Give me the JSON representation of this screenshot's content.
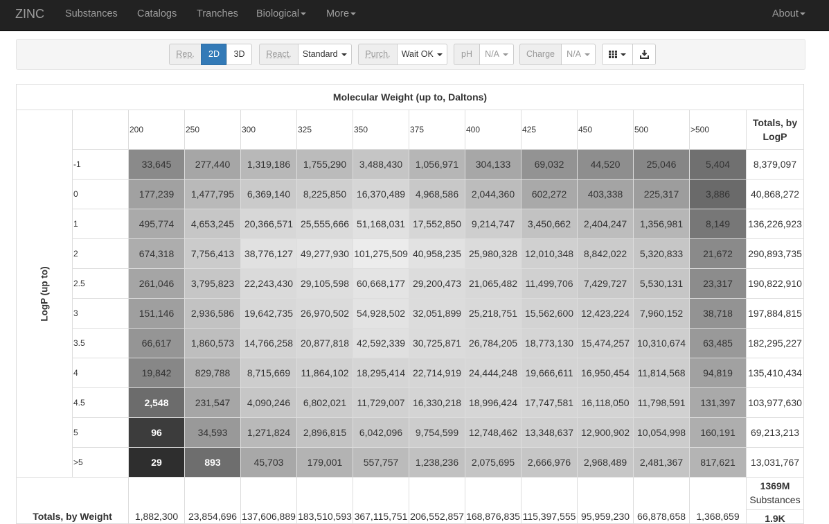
{
  "navbar": {
    "brand": "ZINC",
    "items": [
      "Substances",
      "Catalogs",
      "Tranches",
      "Biological",
      "More"
    ],
    "right": "About"
  },
  "toolbar": {
    "rep_label": "Rep.",
    "rep_2d": "2D",
    "rep_3d": "3D",
    "react_label": "React.",
    "react_value": "Standard",
    "purch_label": "Purch.",
    "purch_value": "Wait OK",
    "ph_label": "pH",
    "ph_value": "N/A",
    "charge_label": "Charge",
    "charge_value": "N/A",
    "grid_icon": "th-icon",
    "download_icon": "download-icon"
  },
  "table": {
    "title": "Molecular Weight (up to, Daltons)",
    "y_axis_label": "LogP (up to)",
    "mw_columns": [
      "200",
      "250",
      "300",
      "325",
      "350",
      "375",
      "400",
      "425",
      "450",
      "500",
      ">500"
    ],
    "totals_by_logp_label": "Totals, by LogP",
    "logp_rows": [
      "-1",
      "0",
      "1",
      "2",
      "2.5",
      "3",
      "3.5",
      "4",
      "4.5",
      "5",
      ">5"
    ],
    "cells": [
      [
        "33,645",
        "277,440",
        "1,319,186",
        "1,755,290",
        "3,488,430",
        "1,056,971",
        "304,133",
        "69,032",
        "44,520",
        "25,046",
        "5,404"
      ],
      [
        "177,239",
        "1,477,795",
        "6,369,140",
        "8,225,850",
        "16,370,489",
        "4,968,586",
        "2,044,360",
        "602,272",
        "403,338",
        "225,317",
        "3,886"
      ],
      [
        "495,774",
        "4,653,245",
        "20,366,571",
        "25,555,666",
        "51,168,031",
        "17,552,850",
        "9,214,747",
        "3,450,662",
        "2,404,247",
        "1,356,981",
        "8,149"
      ],
      [
        "674,318",
        "7,756,413",
        "38,776,127",
        "49,277,930",
        "101,275,509",
        "40,958,235",
        "25,980,328",
        "12,010,348",
        "8,842,022",
        "5,320,833",
        "21,672"
      ],
      [
        "261,046",
        "3,795,823",
        "22,243,430",
        "29,105,598",
        "60,668,177",
        "29,200,473",
        "21,065,482",
        "11,499,706",
        "7,429,727",
        "5,530,131",
        "23,317"
      ],
      [
        "151,146",
        "2,936,586",
        "19,642,735",
        "26,970,502",
        "54,928,502",
        "32,051,899",
        "25,218,751",
        "15,562,600",
        "12,423,224",
        "7,960,152",
        "38,718"
      ],
      [
        "66,617",
        "1,860,573",
        "14,766,258",
        "20,877,818",
        "42,592,339",
        "30,725,871",
        "26,784,205",
        "18,773,130",
        "15,474,257",
        "10,310,674",
        "63,485"
      ],
      [
        "19,842",
        "829,788",
        "8,715,669",
        "11,864,102",
        "18,295,414",
        "22,714,919",
        "24,444,248",
        "19,666,611",
        "16,950,454",
        "11,814,568",
        "94,819"
      ],
      [
        "2,548",
        "231,547",
        "4,090,246",
        "6,802,021",
        "11,729,007",
        "16,330,218",
        "18,996,424",
        "17,747,581",
        "16,118,050",
        "11,798,591",
        "131,397"
      ],
      [
        "96",
        "34,593",
        "1,271,824",
        "2,896,815",
        "6,042,096",
        "9,754,599",
        "12,748,462",
        "13,348,637",
        "12,900,902",
        "10,054,998",
        "160,191"
      ],
      [
        "29",
        "893",
        "45,703",
        "179,001",
        "557,757",
        "1,238,236",
        "2,075,695",
        "2,666,976",
        "2,968,489",
        "2,481,367",
        "817,621"
      ]
    ],
    "cell_colors": [
      [
        "#8a8a8a",
        "#a6a6a6",
        "#b8b8b8",
        "#bbbbbb",
        "#c5c5c5",
        "#b6b6b6",
        "#a7a7a7",
        "#939393",
        "#8e8e8e",
        "#868686",
        "#707070"
      ],
      [
        "#a1a1a1",
        "#b9b9b9",
        "#cacaca",
        "#cfcfcf",
        "#d6d6d6",
        "#c8c8c8",
        "#bcbcbc",
        "#a9a9a9",
        "#a4a4a4",
        "#9d9d9d",
        "#6a6a6a"
      ],
      [
        "#aaaaaa",
        "#c6c6c6",
        "#d7d7d7",
        "#dbdbdb",
        "#e1e1e1",
        "#d6d6d6",
        "#cecece",
        "#c2c2c2",
        "#bdbdbd",
        "#b6b6b6",
        "#777777"
      ],
      [
        "#adadad",
        "#cbcbcb",
        "#e1e1e1",
        "#e4e4e4",
        "#ececec",
        "#e2e2e2",
        "#dbdbdb",
        "#d0d0d0",
        "#cbcbcb",
        "#c6c6c6",
        "#8a8a8a"
      ],
      [
        "#a5a5a5",
        "#c6c6c6",
        "#dadada",
        "#dedede",
        "#e4e4e4",
        "#dcdcdc",
        "#d8d8d8",
        "#d0d0d0",
        "#cacaca",
        "#c6c6c6",
        "#8c8c8c"
      ],
      [
        "#9f9f9f",
        "#c2c2c2",
        "#d8d8d8",
        "#dbdbdb",
        "#e3e3e3",
        "#dcdcdc",
        "#d9d9d9",
        "#d3d3d3",
        "#d0d0d0",
        "#cacaca",
        "#939393"
      ],
      [
        "#959595",
        "#bebebe",
        "#d4d4d4",
        "#d8d8d8",
        "#e0e0e0",
        "#dbdbdb",
        "#d9d9d9",
        "#d5d5d5",
        "#d3d3d3",
        "#cecece",
        "#999999"
      ],
      [
        "#878787",
        "#b2b2b2",
        "#cdcdcd",
        "#d1d1d1",
        "#d5d5d5",
        "#d6d6d6",
        "#d7d7d7",
        "#d4d4d4",
        "#d3d3d3",
        "#cecece",
        "#a1a1a1"
      ],
      [
        "#6c6c6c",
        "#a6a6a6",
        "#c6c6c6",
        "#cccccc",
        "#d1d1d1",
        "#d4d4d4",
        "#d6d6d6",
        "#d5d5d5",
        "#d4d4d4",
        "#d1d1d1",
        "#a9a9a9"
      ],
      [
        "#3c3c3c",
        "#999999",
        "#b9b9b9",
        "#c3c3c3",
        "#c9c9c9",
        "#cdcdcd",
        "#d0d0d0",
        "#d0d0d0",
        "#cfcfcf",
        "#cccccc",
        "#aeaeae"
      ],
      [
        "#2e2e2e",
        "#6e6e6e",
        "#a8a8a8",
        "#b3b3b3",
        "#bbbbbb",
        "#c1c1c1",
        "#c5c5c5",
        "#c6c6c6",
        "#c7c7c7",
        "#c4c4c4",
        "#b4b4b4"
      ]
    ],
    "cell_text_colors": [
      [
        "#333",
        "#333",
        "#333",
        "#333",
        "#333",
        "#333",
        "#333",
        "#333",
        "#333",
        "#333",
        "#333"
      ],
      [
        "#333",
        "#333",
        "#333",
        "#333",
        "#333",
        "#333",
        "#333",
        "#333",
        "#333",
        "#333",
        "#333"
      ],
      [
        "#333",
        "#333",
        "#333",
        "#333",
        "#333",
        "#333",
        "#333",
        "#333",
        "#333",
        "#333",
        "#333"
      ],
      [
        "#333",
        "#333",
        "#333",
        "#333",
        "#333",
        "#333",
        "#333",
        "#333",
        "#333",
        "#333",
        "#333"
      ],
      [
        "#333",
        "#333",
        "#333",
        "#333",
        "#333",
        "#333",
        "#333",
        "#333",
        "#333",
        "#333",
        "#333"
      ],
      [
        "#333",
        "#333",
        "#333",
        "#333",
        "#333",
        "#333",
        "#333",
        "#333",
        "#333",
        "#333",
        "#333"
      ],
      [
        "#333",
        "#333",
        "#333",
        "#333",
        "#333",
        "#333",
        "#333",
        "#333",
        "#333",
        "#333",
        "#333"
      ],
      [
        "#333",
        "#333",
        "#333",
        "#333",
        "#333",
        "#333",
        "#333",
        "#333",
        "#333",
        "#333",
        "#333"
      ],
      [
        "#ffffff",
        "#333",
        "#333",
        "#333",
        "#333",
        "#333",
        "#333",
        "#333",
        "#333",
        "#333",
        "#333"
      ],
      [
        "#ffffff",
        "#333",
        "#333",
        "#333",
        "#333",
        "#333",
        "#333",
        "#333",
        "#333",
        "#333",
        "#333"
      ],
      [
        "#ffffff",
        "#ffffff",
        "#333",
        "#333",
        "#333",
        "#333",
        "#333",
        "#333",
        "#333",
        "#333",
        "#333"
      ]
    ],
    "bold_cells": [
      [
        8,
        0
      ],
      [
        9,
        0
      ],
      [
        10,
        0
      ],
      [
        10,
        1
      ]
    ],
    "row_totals": [
      "8,379,097",
      "40,868,272",
      "136,226,923",
      "290,893,735",
      "190,822,910",
      "197,884,815",
      "182,295,227",
      "135,410,434",
      "103,977,630",
      "69,213,213",
      "13,031,767"
    ],
    "totals_by_weight_label": "Totals, by Weight",
    "col_totals": [
      "1,882,300",
      "23,854,696",
      "137,606,889",
      "183,510,593",
      "367,115,751",
      "206,552,857",
      "168,876,835",
      "115,397,555",
      "95,959,230",
      "66,878,658",
      "1,368,659"
    ],
    "grand_total_value": "1369M",
    "grand_total_unit": "Substances",
    "grand_total_second": "1.9K"
  }
}
